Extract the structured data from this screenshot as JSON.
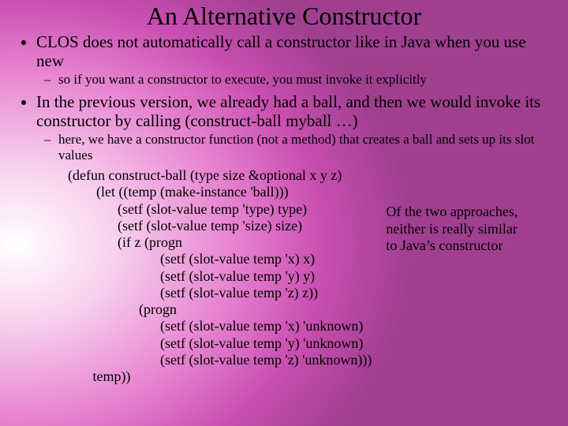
{
  "title": "An Alternative Constructor",
  "bullets": {
    "b1": "CLOS does not automatically call a constructor like in Java when you  use new",
    "b1sub": "so if you want a constructor to execute, you must invoke it explicitly",
    "b2": "In the previous version, we already had a ball, and then we would invoke its constructor by calling (construct-ball myball …)",
    "b2sub": "here, we have a constructor function (not a method) that creates a ball and sets up its slot values"
  },
  "code": "(defun construct-ball (type size &optional x y z)\n        (let ((temp (make-instance 'ball)))\n              (setf (slot-value temp 'type) type)\n              (setf (slot-value temp 'size) size)\n              (if z (progn\n                          (setf (slot-value temp 'x) x)\n                          (setf (slot-value temp 'y) y)\n                          (setf (slot-value temp 'z) z))\n                    (progn\n                          (setf (slot-value temp 'x) 'unknown)\n                          (setf (slot-value temp 'y) 'unknown)\n                          (setf (slot-value temp 'z) 'unknown)))\n       temp))",
  "aside": "Of the two approaches, neither is really similar to Java’s constructor"
}
